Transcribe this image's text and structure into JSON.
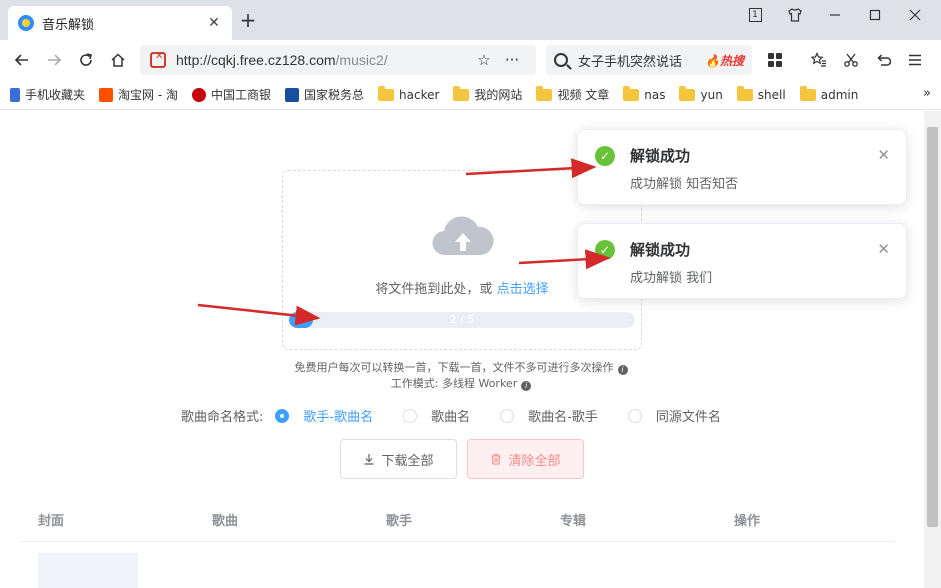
{
  "browser": {
    "tab_title": "音乐解锁",
    "tab_close": "✕",
    "new_tab": "+",
    "window_badge": "1",
    "url_host": "http://cqkj.free.cz128.com",
    "url_path": "/music2/",
    "search_text": "女子手机突然说话",
    "search_hot": "🔥热搜",
    "bookmarks": [
      {
        "label": "手机收藏夹",
        "icon": "bookmark-icon"
      },
      {
        "label": "淘宝网 - 淘",
        "icon": "taobao-icon"
      },
      {
        "label": "中国工商银",
        "icon": "icbc-icon"
      },
      {
        "label": "国家税务总",
        "icon": "tax-icon"
      },
      {
        "label": "hacker",
        "icon": "folder-icon"
      },
      {
        "label": "我的网站",
        "icon": "folder-icon"
      },
      {
        "label": "视频 文章",
        "icon": "folder-icon"
      },
      {
        "label": "nas",
        "icon": "folder-icon"
      },
      {
        "label": "yun",
        "icon": "folder-icon"
      },
      {
        "label": "shell",
        "icon": "folder-icon"
      },
      {
        "label": "admin",
        "icon": "folder-icon"
      }
    ],
    "more": "»"
  },
  "upload": {
    "prompt": "将文件拖到此处，或 ",
    "link": "点击选择",
    "progress_fraction": 0.07,
    "progress_label": "2 / 5"
  },
  "tips": {
    "line1": "免费用户每次可以转换一首，下载一首，文件不多可进行多次操作",
    "line2": "工作模式: 多线程 Worker",
    "info": "i"
  },
  "naming": {
    "label": "歌曲命名格式:",
    "options": [
      "歌手-歌曲名",
      "歌曲名",
      "歌曲名-歌手",
      "同源文件名"
    ],
    "selected": 0
  },
  "buttons": {
    "download_all": "下载全部",
    "clear_all": "清除全部"
  },
  "table": {
    "headers": [
      "封面",
      "歌曲",
      "歌手",
      "专辑",
      "操作"
    ]
  },
  "notifications": [
    {
      "title": "解锁成功",
      "message": "成功解锁 知否知否",
      "close": "✕"
    },
    {
      "title": "解锁成功",
      "message": "成功解锁 我们",
      "close": "✕"
    }
  ],
  "colors": {
    "accent": "#409eff",
    "success": "#67c23a",
    "danger": "#f78989",
    "annotation_arrow": "#d42a2a"
  }
}
